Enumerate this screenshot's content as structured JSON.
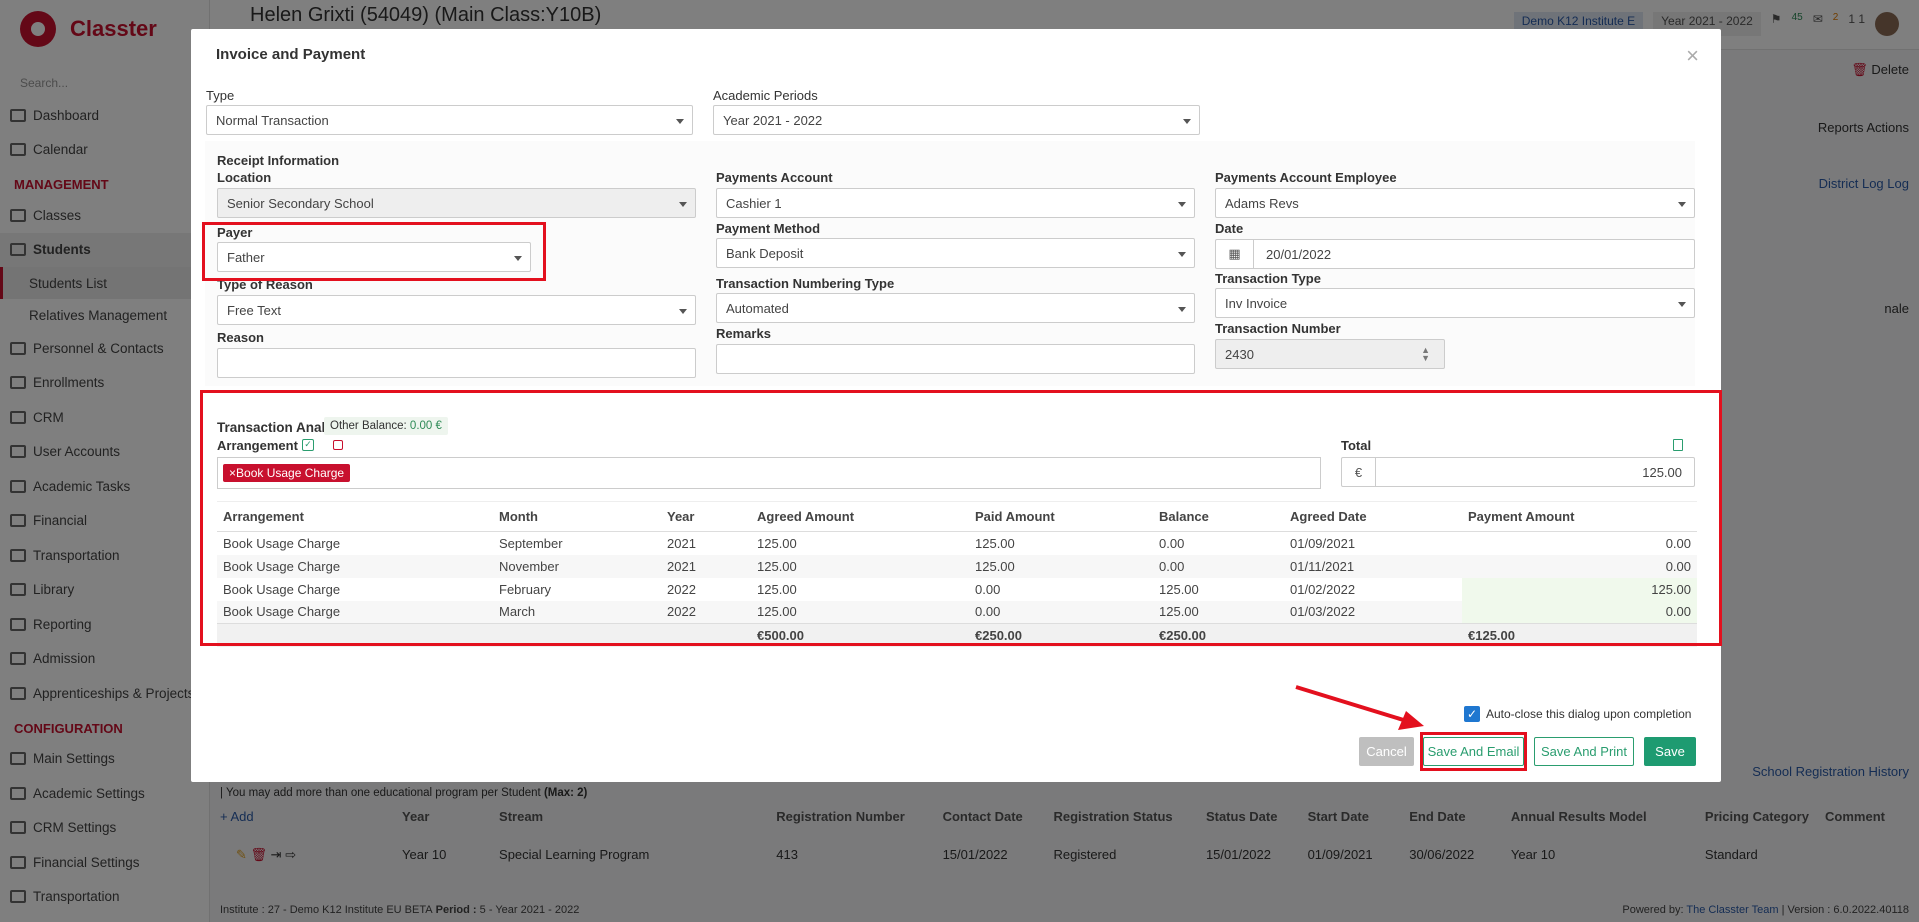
{
  "app": {
    "brand": "Classter",
    "search_placeholder": "Search...",
    "page_title": "Helen Grixti (54049) (Main Class:Y10B)",
    "institute_selector": "Demo K12 Institute E",
    "year_selector": "Year 2021 - 2022",
    "notif_count_1": "45",
    "notif_count_2": "2",
    "page_indicator": "1 1",
    "delete_label": "Delete",
    "reports_label": "Reports",
    "actions_label": "Actions",
    "district_log_label": "District Log",
    "log_label": "Log",
    "side_text": "nale",
    "school_reg_history": "School Registration History"
  },
  "sidebar": {
    "items_top": [
      {
        "label": "Dashboard"
      },
      {
        "label": "Calendar"
      }
    ],
    "management_title": "MANAGEMENT",
    "management_items": [
      {
        "label": "Classes"
      },
      {
        "label": "Students"
      }
    ],
    "student_subitems": [
      {
        "label": "Students List"
      },
      {
        "label": "Relatives Management"
      }
    ],
    "more_items": [
      {
        "label": "Personnel & Contacts"
      },
      {
        "label": "Enrollments"
      },
      {
        "label": "CRM"
      },
      {
        "label": "User Accounts"
      },
      {
        "label": "Academic Tasks"
      },
      {
        "label": "Financial"
      },
      {
        "label": "Transportation"
      },
      {
        "label": "Library"
      },
      {
        "label": "Reporting"
      },
      {
        "label": "Admission"
      },
      {
        "label": "Apprenticeships & Projects"
      }
    ],
    "configuration_title": "CONFIGURATION",
    "config_items": [
      {
        "label": "Main Settings"
      },
      {
        "label": "Academic Settings"
      },
      {
        "label": "CRM Settings"
      },
      {
        "label": "Financial Settings"
      },
      {
        "label": "Transportation"
      }
    ]
  },
  "background": {
    "note_prefix": "| You may add more than one educational program per Student ",
    "note_max": "(Max: 2)",
    "add_label": "Add",
    "headers": [
      "Year",
      "Stream",
      "Registration Number",
      "Contact Date",
      "Registration Status",
      "Status Date",
      "Start Date",
      "End Date",
      "Annual Results Model",
      "Pricing Category",
      "Comment"
    ],
    "row": [
      "Year 10",
      "Special Learning Program",
      "413",
      "15/01/2022",
      "Registered",
      "15/01/2022",
      "01/09/2021",
      "30/06/2022",
      "Year 10",
      "Standard",
      ""
    ],
    "footer_left_prefix": "Institute : ",
    "footer_left_institute": "27 - Demo K12 Institute EU BETA",
    "footer_left_period_label": " Period : ",
    "footer_left_period": "5 - Year 2021 - 2022",
    "footer_right_prefix": "Powered by: ",
    "footer_right_team": "The Classter Team",
    "footer_version": "| Version : 6.0.2022.40118"
  },
  "modal": {
    "title": "Invoice and Payment",
    "type_label": "Type",
    "type_value": "Normal Transaction",
    "academic_periods_label": "Academic Periods",
    "academic_periods_value": "Year 2021 - 2022",
    "receipt_info_label": "Receipt Information",
    "location_label": "Location",
    "location_value": "Senior Secondary School",
    "payer_label": "Payer",
    "payer_value": "Father",
    "type_of_reason_label": "Type of Reason",
    "type_of_reason_value": "Free Text",
    "reason_label": "Reason",
    "reason_value": "",
    "payments_account_label": "Payments Account",
    "payments_account_value": "Cashier 1",
    "payment_method_label": "Payment Method",
    "payment_method_value": "Bank Deposit",
    "transaction_numbering_type_label": "Transaction Numbering Type",
    "transaction_numbering_type_value": "Automated",
    "remarks_label": "Remarks",
    "remarks_value": "",
    "payments_account_employee_label": "Payments Account Employee",
    "payments_account_employee_value": "Adams Revs",
    "date_label": "Date",
    "date_value": "20/01/2022",
    "transaction_type_label": "Transaction Type",
    "transaction_type_value": "Inv Invoice",
    "transaction_number_label": "Transaction Number",
    "transaction_number_value": "2430",
    "transaction_analysis_label": "Transaction Analysis",
    "other_balance_label": "Other Balance:",
    "other_balance_value": "0.00 €",
    "arrangement_label": "Arrangement",
    "arrangement_tag": "Book Usage Charge",
    "total_label": "Total",
    "currency_symbol": "€",
    "total_value": "125.00",
    "table_headers": [
      "Arrangement",
      "Month",
      "Year",
      "Agreed Amount",
      "Paid Amount",
      "Balance",
      "Agreed Date",
      "Payment Amount"
    ],
    "rows": [
      {
        "arrangement": "Book Usage Charge",
        "month": "September",
        "year": "2021",
        "agreed": "125.00",
        "paid": "125.00",
        "balance": "0.00",
        "date": "01/09/2021",
        "payment": "0.00"
      },
      {
        "arrangement": "Book Usage Charge",
        "month": "November",
        "year": "2021",
        "agreed": "125.00",
        "paid": "125.00",
        "balance": "0.00",
        "date": "01/11/2021",
        "payment": "0.00"
      },
      {
        "arrangement": "Book Usage Charge",
        "month": "February",
        "year": "2022",
        "agreed": "125.00",
        "paid": "0.00",
        "balance": "125.00",
        "date": "01/02/2022",
        "payment": "125.00"
      },
      {
        "arrangement": "Book Usage Charge",
        "month": "March",
        "year": "2022",
        "agreed": "125.00",
        "paid": "0.00",
        "balance": "125.00",
        "date": "01/03/2022",
        "payment": "0.00"
      }
    ],
    "totals": {
      "agreed": "€500.00",
      "paid": "€250.00",
      "balance": "€250.00",
      "payment": "€125.00"
    },
    "auto_close_label": "Auto-close this dialog upon completion",
    "auto_close_checked": true,
    "cancel_label": "Cancel",
    "save_email_label": "Save And Email",
    "save_print_label": "Save And Print",
    "save_label": "Save"
  },
  "colors": {
    "brand": "#c8102e",
    "highlight": "#e3101e",
    "save_green": "#1e9b71"
  }
}
